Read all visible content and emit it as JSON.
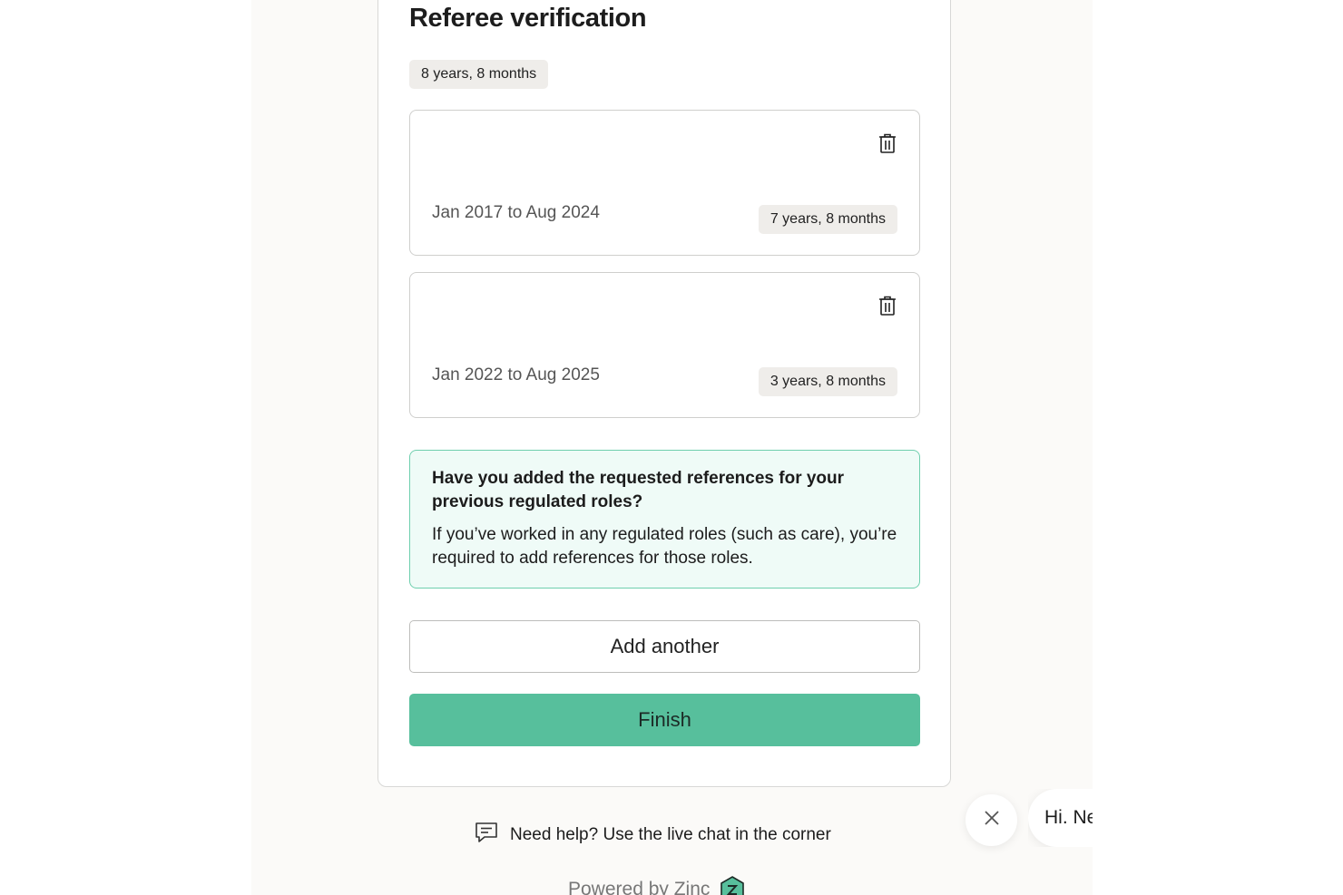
{
  "page": {
    "title": "Referee verification",
    "total_duration": "8 years, 8 months"
  },
  "references": [
    {
      "dates": "Jan 2017 to Aug 2024",
      "duration": "7 years, 8 months",
      "delete_icon": "trash-icon"
    },
    {
      "dates": "Jan 2022 to Aug 2025",
      "duration": "3 years, 8 months",
      "delete_icon": "trash-icon"
    }
  ],
  "notice": {
    "title": "Have you added the requested references for your previous regulated roles?",
    "body": "If you’ve worked in any regulated roles (such as care), you’re required to add references for those roles."
  },
  "actions": {
    "add_another": "Add another",
    "finish": "Finish"
  },
  "footer": {
    "help_text": "Need help? Use the live chat in the corner",
    "help_icon": "chat-message-icon",
    "powered_by": "Powered by Zinc",
    "logo_icon": "zinc-logo-icon"
  },
  "chat": {
    "greeting": "Hi. Ne",
    "close_icon": "close-icon"
  },
  "colors": {
    "accent": "#57bf9c",
    "notice_border": "#6fcfae",
    "notice_bg": "#effbf7",
    "pill_bg": "#efedea"
  }
}
